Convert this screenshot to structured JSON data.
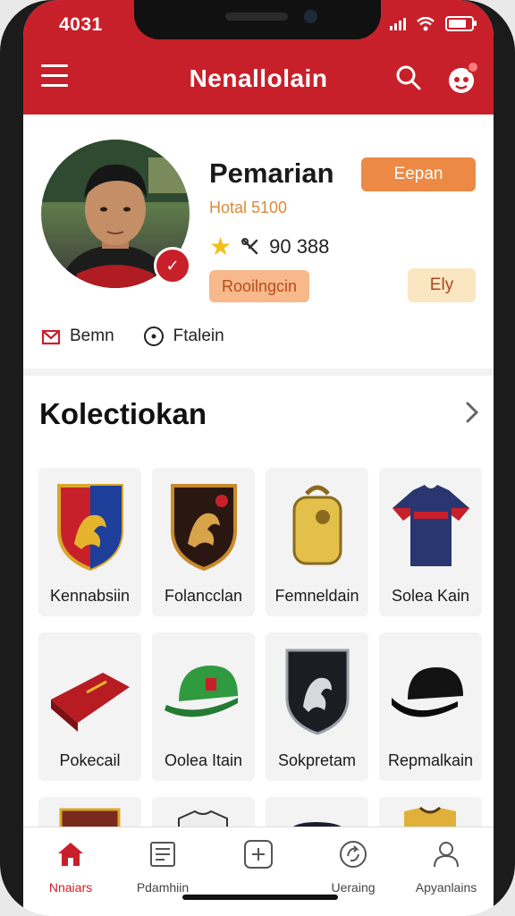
{
  "status": {
    "time": "4031"
  },
  "header": {
    "title": "Nenallolain"
  },
  "profile": {
    "name": "Pemarian",
    "subtitle": "Hotal 5100",
    "stats_value": "90 388",
    "button_primary": "Eepan",
    "button_secondary": "Rooilngcin",
    "button_tertiary": "Ely",
    "meta": [
      {
        "label": "Bemn"
      },
      {
        "label": "Ftalein"
      }
    ]
  },
  "collection": {
    "title": "Kolectiokan",
    "items": [
      {
        "label": "Kennabsiin",
        "icon": "crest-red-blue-icon"
      },
      {
        "label": "Folancclan",
        "icon": "crest-black-icon"
      },
      {
        "label": "Femneldain",
        "icon": "gold-bag-icon"
      },
      {
        "label": "Solea Kain",
        "icon": "jersey-icon"
      },
      {
        "label": "Pokecail",
        "icon": "red-wallet-icon"
      },
      {
        "label": "Oolea Itain",
        "icon": "green-cap-icon"
      },
      {
        "label": "Sokpretam",
        "icon": "black-crest-icon"
      },
      {
        "label": "Repmalkain",
        "icon": "black-cap-icon"
      }
    ]
  },
  "bottom_nav": [
    {
      "label": "Nnaiars",
      "icon": "home-icon"
    },
    {
      "label": "Pdamhiin",
      "icon": "document-icon"
    },
    {
      "label": "",
      "icon": "add-icon"
    },
    {
      "label": "Ueraing",
      "icon": "refresh-icon"
    },
    {
      "label": "Apyanlains",
      "icon": "profile-icon"
    }
  ],
  "colors": {
    "primary": "#c8202a",
    "accent_orange": "#ec8a45",
    "star": "#f2c01d"
  }
}
